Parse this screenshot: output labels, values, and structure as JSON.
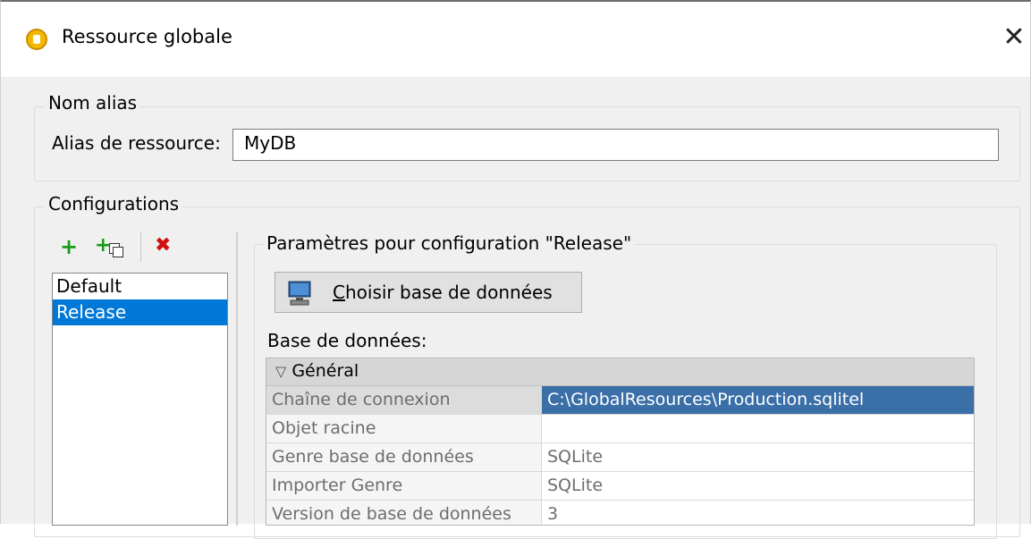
{
  "window": {
    "title": "Ressource globale",
    "close_glyph": "✕"
  },
  "alias_group": {
    "legend": "Nom alias",
    "label": "Alias de ressource:",
    "value": "MyDB"
  },
  "configurations": {
    "legend": "Configurations",
    "toolbar": {
      "add_icon": "plus-icon",
      "copy_icon": "copy-add-icon",
      "delete_icon": "delete-icon"
    },
    "items": [
      {
        "label": "Default",
        "selected": false
      },
      {
        "label": "Release",
        "selected": true
      }
    ]
  },
  "params": {
    "legend": "Paramètres pour configuration \"Release\"",
    "choose_button_prefix": "C",
    "choose_button_rest": "hoisir base de données",
    "db_label": "Base de données:",
    "grid": {
      "section": "Général",
      "rows": [
        {
          "key": "Chaîne de connexion",
          "value": "C:\\GlobalResources\\Production.sqlitel"
        },
        {
          "key": "Objet racine",
          "value": ""
        },
        {
          "key": "Genre base de données",
          "value": "SQLite"
        },
        {
          "key": "Importer Genre",
          "value": "SQLite"
        },
        {
          "key": "Version de base de données",
          "value": "3"
        }
      ]
    }
  },
  "colors": {
    "selection": "#0078d7",
    "grid_selected": "#3b6fa8"
  }
}
